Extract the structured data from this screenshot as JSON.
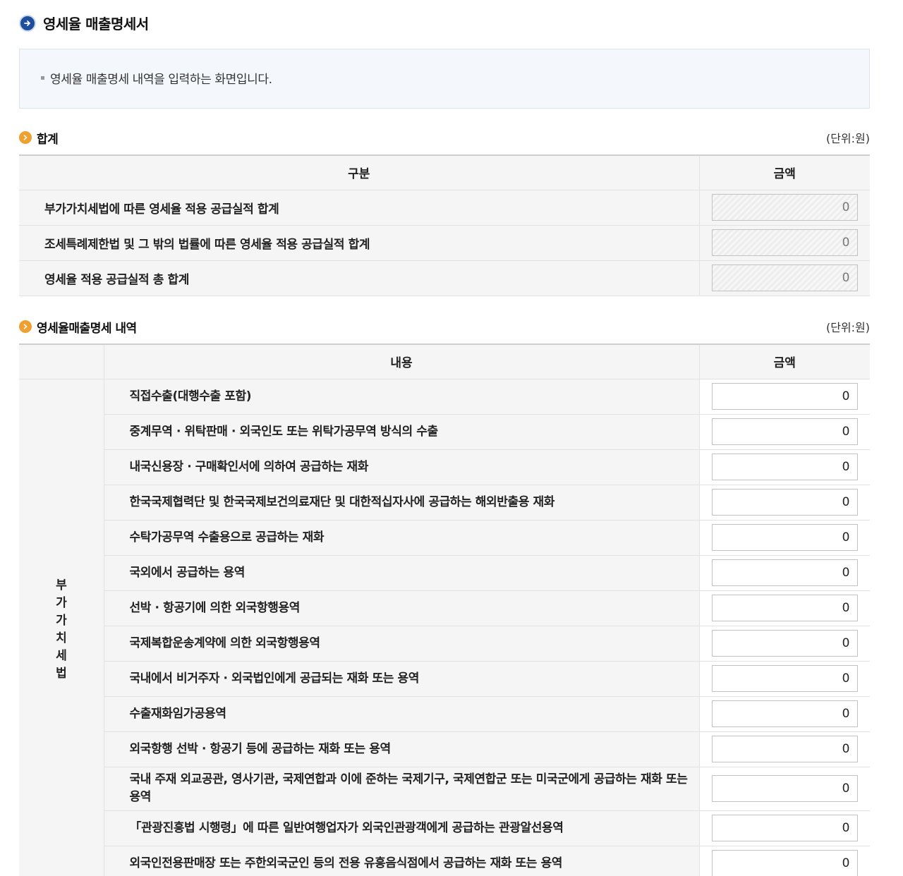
{
  "page": {
    "title": "영세율 매출명세서",
    "description": "영세율 매출명세 내역을 입력하는 화면입니다."
  },
  "summary": {
    "title": "합계",
    "unit": "(단위:원)",
    "col_category": "구분",
    "col_amount": "금액",
    "rows": [
      {
        "label": "부가가치세법에 따른 영세율 적용 공급실적 합계",
        "value": "0"
      },
      {
        "label": "조세특례제한법 및 그 밖의 법률에 따른 영세율 적용 공급실적 합계",
        "value": "0"
      },
      {
        "label": "영세율 적용 공급실적 총 합계",
        "value": "0"
      }
    ]
  },
  "detail": {
    "title": "영세율매출명세 내역",
    "unit": "(단위:원)",
    "col_content": "내용",
    "col_amount": "금액",
    "category": "부가가치세법",
    "rows": [
      {
        "label": "직접수출(대행수출 포함)",
        "value": "0"
      },
      {
        "label": "중계무역 · 위탁판매 · 외국인도 또는 위탁가공무역 방식의 수출",
        "value": "0"
      },
      {
        "label": "내국신용장 · 구매확인서에 의하여 공급하는 재화",
        "value": "0"
      },
      {
        "label": "한국국제협력단 및 한국국제보건의료재단 및 대한적십자사에 공급하는 해외반출용 재화",
        "value": "0"
      },
      {
        "label": "수탁가공무역 수출용으로 공급하는 재화",
        "value": "0"
      },
      {
        "label": "국외에서 공급하는 용역",
        "value": "0"
      },
      {
        "label": "선박 · 항공기에 의한 외국항행용역",
        "value": "0"
      },
      {
        "label": "국제복합운송계약에 의한 외국항행용역",
        "value": "0"
      },
      {
        "label": "국내에서 비거주자 · 외국법인에게 공급되는 재화 또는 용역",
        "value": "0"
      },
      {
        "label": "수출재화임가공용역",
        "value": "0"
      },
      {
        "label": "외국항행 선박 · 항공기 등에 공급하는 재화 또는 용역",
        "value": "0"
      },
      {
        "label": "국내 주재 외교공관, 영사기관, 국제연합과 이에 준하는 국제기구, 국제연합군 또는 미국군에게 공급하는 재화 또는 용역",
        "value": "0"
      },
      {
        "label": "「관광진흥법 시행령」에 따른 일반여행업자가 외국인관광객에게 공급하는 관광알선용역",
        "value": "0"
      },
      {
        "label": "외국인전용판매장 또는 주한외국군인 등의 전용 유흥음식점에서 공급하는 재화 또는 용역",
        "value": "0"
      }
    ]
  }
}
